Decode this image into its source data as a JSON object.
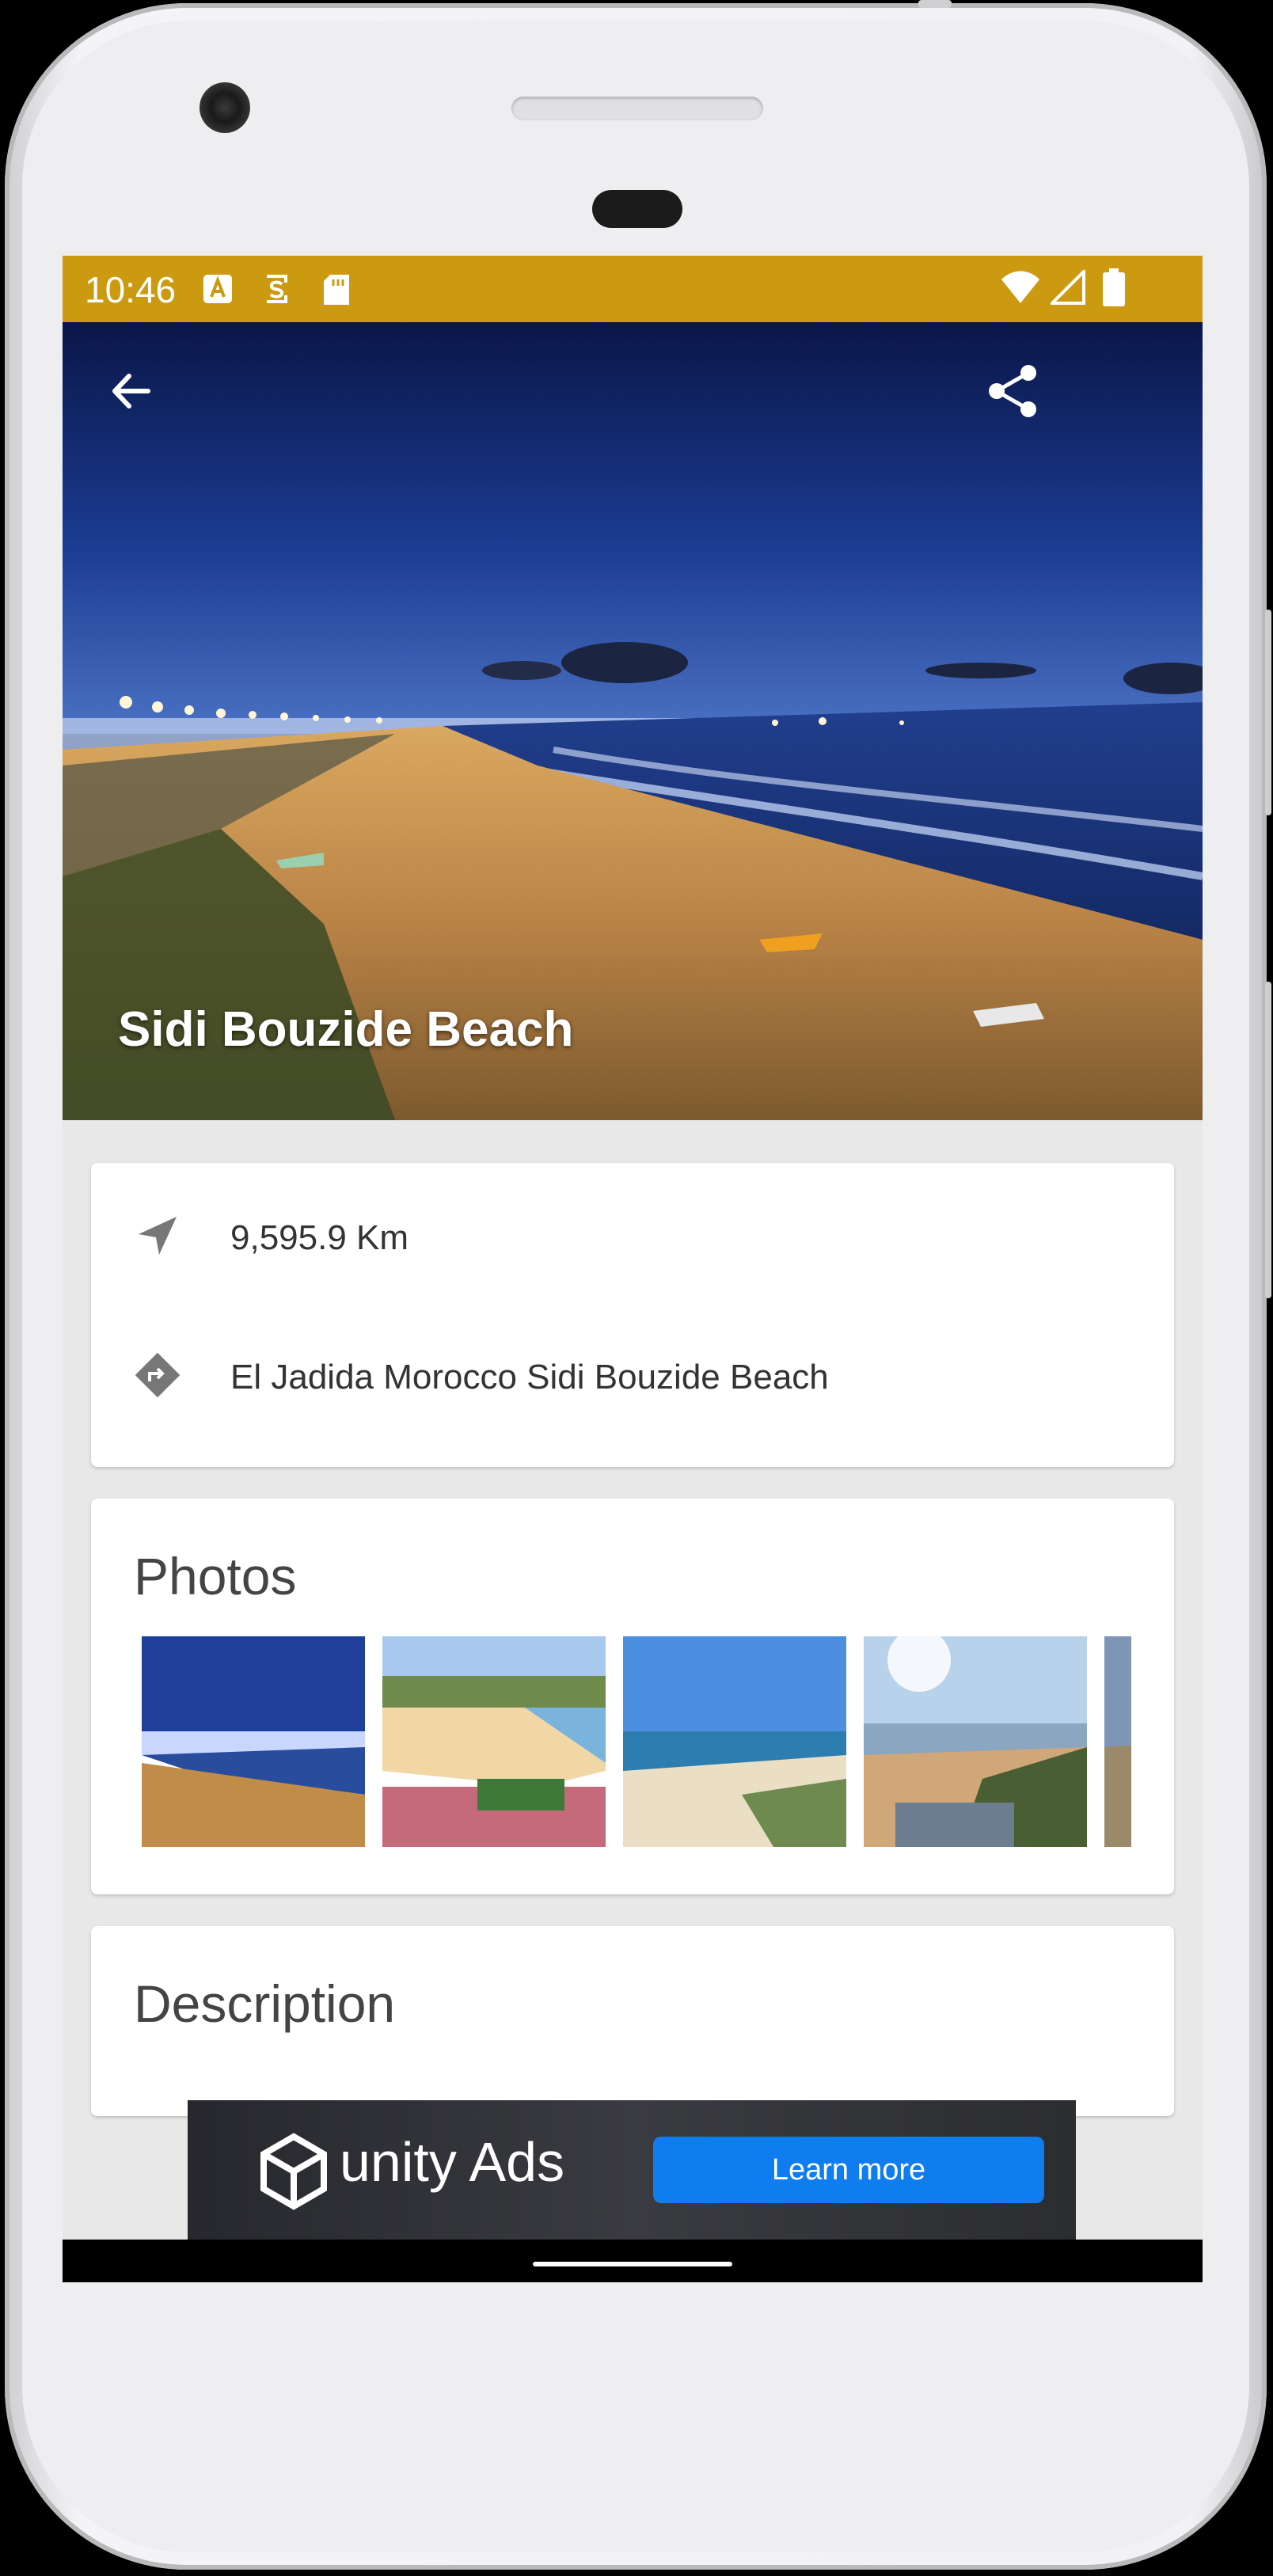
{
  "status_bar": {
    "time": "10:46",
    "background": "#cc9a10",
    "icons": [
      "a-notification-icon",
      "s-notification-icon",
      "sd-card-icon",
      "wifi-icon",
      "signal-icon",
      "battery-icon"
    ]
  },
  "hero": {
    "title": "Sidi Bouzide Beach",
    "back_icon": "arrow-left-icon",
    "share_icon": "share-icon"
  },
  "info": {
    "distance": "9,595.9 Km",
    "distance_icon": "navigation-arrow-icon",
    "address": "El Jadida Morocco Sidi Bouzide Beach",
    "address_icon": "directions-icon"
  },
  "photos": {
    "title": "Photos",
    "items": [
      "beach-night-photo",
      "beach-day-photo",
      "beach-shore-photo",
      "beach-sunny-photo",
      "beach-partial-photo"
    ]
  },
  "description": {
    "title": "Description"
  },
  "ad": {
    "brand": "unity Ads",
    "cta": "Learn more",
    "cta_color": "#0f7cf0"
  }
}
